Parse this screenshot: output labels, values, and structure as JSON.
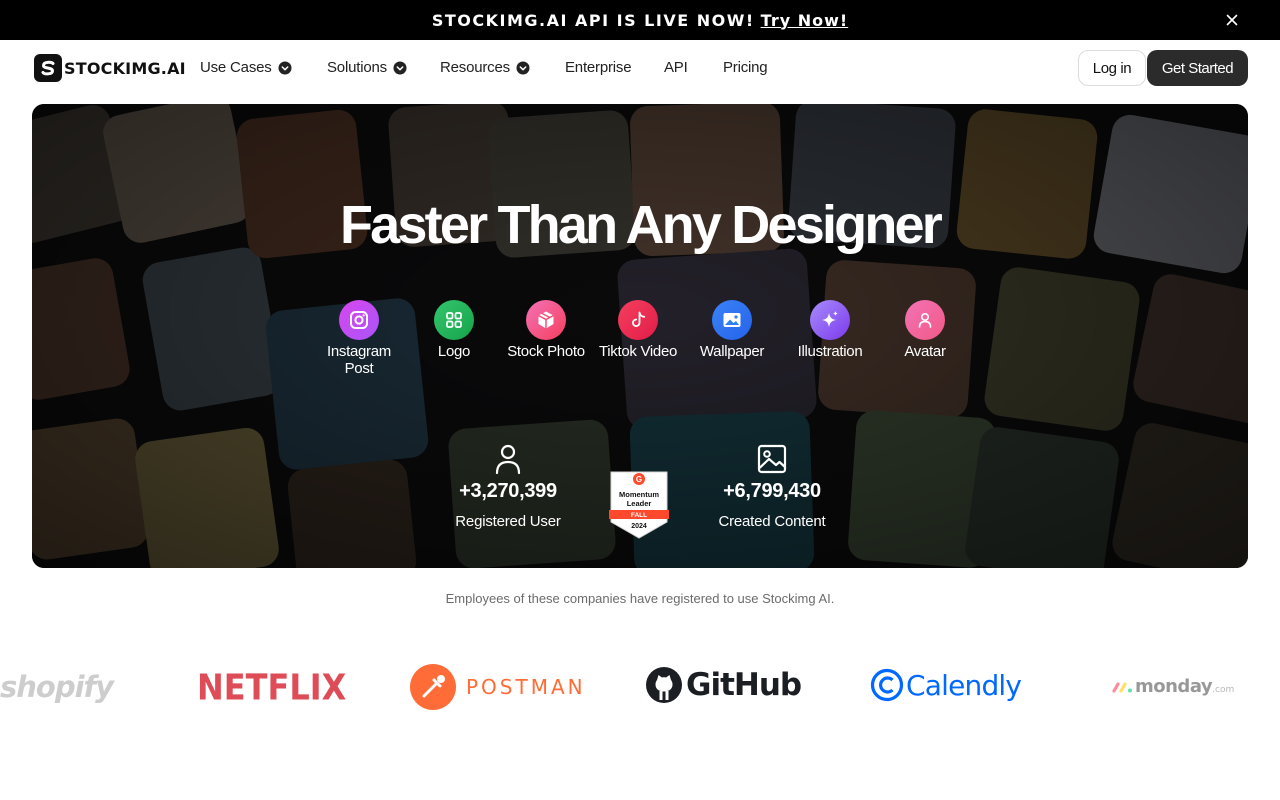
{
  "announcement": {
    "text": "STOCKIMG.AI API IS LIVE NOW!",
    "link": "Try Now!"
  },
  "nav": {
    "logo_text": "STOCKIMG.AI",
    "items": [
      {
        "label": "Use Cases",
        "dropdown": true
      },
      {
        "label": "Solutions",
        "dropdown": true
      },
      {
        "label": "Resources",
        "dropdown": true
      },
      {
        "label": "Enterprise",
        "dropdown": false
      },
      {
        "label": "API",
        "dropdown": false
      },
      {
        "label": "Pricing",
        "dropdown": false
      }
    ],
    "login_label": "Log in",
    "start_label": "Get Started"
  },
  "hero": {
    "title": "Faster Than Any Designer",
    "categories": [
      {
        "label": "Instagram Post",
        "icon": "instagram-icon",
        "color": "#c13fe8"
      },
      {
        "label": "Logo",
        "icon": "grid-icon",
        "color": "#22b55e"
      },
      {
        "label": "Stock Photo",
        "icon": "box-icon",
        "color": "#f2557e"
      },
      {
        "label": "Tiktok Video",
        "icon": "tiktok-icon",
        "color": "#f03c57"
      },
      {
        "label": "Wallpaper",
        "icon": "image-icon",
        "color": "#2f7ff5"
      },
      {
        "label": "Illustration",
        "icon": "sparkle-icon",
        "color": "#8b5cf6"
      },
      {
        "label": "Avatar",
        "icon": "user-icon",
        "color": "#f05a86"
      }
    ],
    "stats": [
      {
        "value": "+3,270,399",
        "label": "Registered User",
        "icon": "user-icon"
      },
      {
        "value": "+6,799,430",
        "label": "Created Content",
        "icon": "image-icon"
      }
    ],
    "badge": {
      "line1": "Momentum",
      "line2": "Leader",
      "season": "FALL",
      "year": "2024"
    }
  },
  "companies": {
    "caption": "Employees of these companies have registered to use Stockimg AI.",
    "logos": [
      {
        "name": "shopify",
        "color": "#b9b9b9"
      },
      {
        "name": "NETFLIX",
        "color": "#d6202e"
      },
      {
        "name": "POSTMAN",
        "color": "#ff6c37"
      },
      {
        "name": "GitHub",
        "color": "#1b1f23"
      },
      {
        "name": "Calendly",
        "color": "#0069ff"
      },
      {
        "name": "monday",
        "suffix": ".com",
        "color": "#9a9a9a"
      }
    ]
  }
}
